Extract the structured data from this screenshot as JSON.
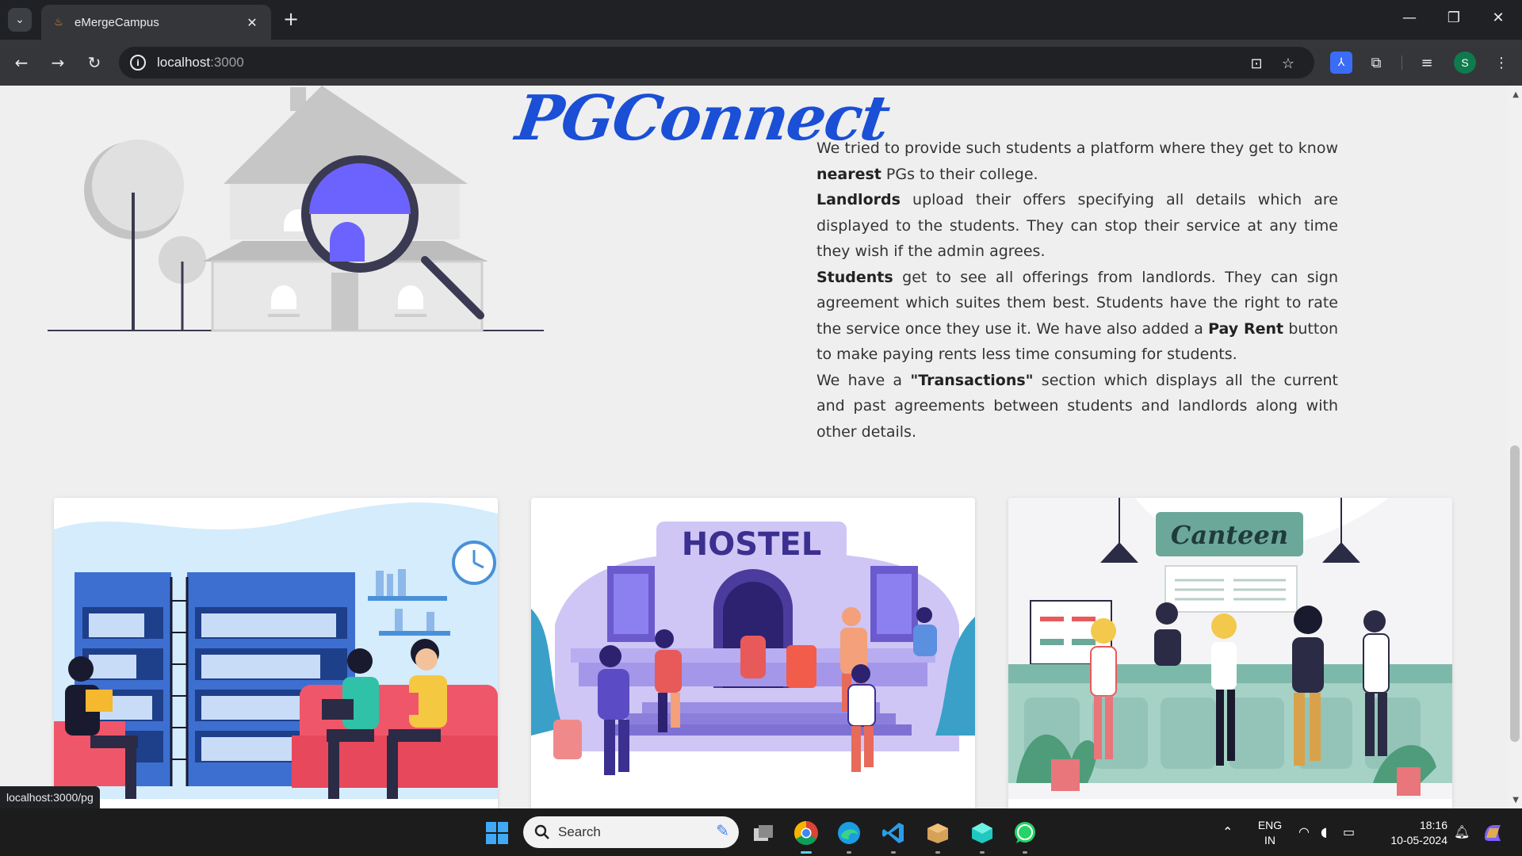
{
  "browser": {
    "tab_title": "eMergeCampus",
    "url_host": "localhost",
    "url_port": ":3000",
    "status_url": "localhost:3000/pg",
    "profile_initial": "S"
  },
  "page": {
    "brand": "PGConnect",
    "about": {
      "p1_a": "We tried to provide such students a platform where they get to know ",
      "p1_bold": "nearest",
      "p1_b": " PGs to their college.",
      "p2_bold": "Landlords",
      "p2_a": " upload their offers specifying all details which are displayed to the students. They can stop their service at any time they wish if the admin agrees.",
      "p3_bold": "Students",
      "p3_a": " get to see all offerings from landlords. They can sign agreement which suites them best. Students have the right to rate the service once they use it. We have also added a ",
      "p3_bold2": "Pay Rent",
      "p3_b": " button to make paying rents less time consuming for students.",
      "p4_a": "We have a ",
      "p4_bold": "\"Transactions\"",
      "p4_b": " section which displays all the current and past agreements between students and landlords along with other details."
    },
    "cards": {
      "hostel_sign": "HOSTEL",
      "canteen_sign": "Canteen"
    }
  },
  "taskbar": {
    "search_label": "Search",
    "lang_top": "ENG",
    "lang_bottom": "IN",
    "time": "18:16",
    "date": "10-05-2024"
  }
}
